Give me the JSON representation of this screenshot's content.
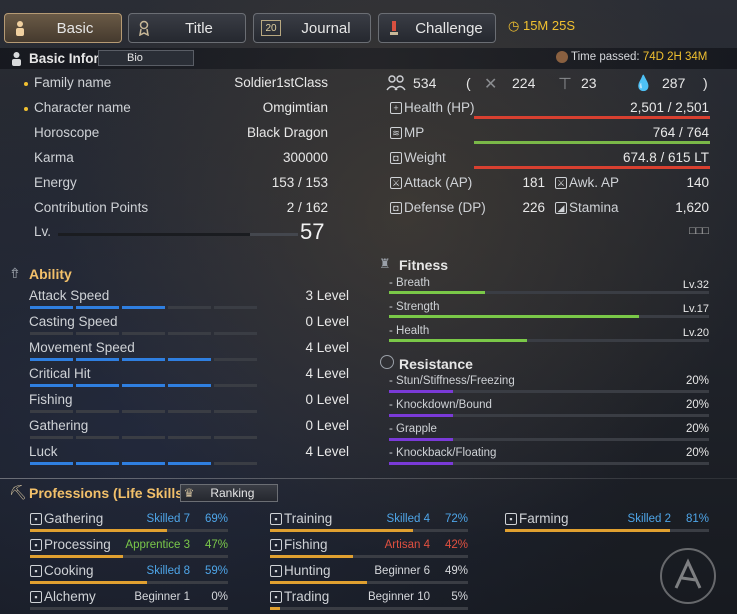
{
  "tabs": [
    {
      "label": "Basic",
      "icon": "person-icon",
      "active": true
    },
    {
      "label": "Title",
      "icon": "title-icon"
    },
    {
      "label": "Journal",
      "icon": "journal-icon"
    },
    {
      "label": "Challenge",
      "icon": "challenge-icon"
    }
  ],
  "journal_icon_text": "20",
  "timer": "15M 25S",
  "basic": {
    "title": "Basic Inform",
    "bio_label": "Bio",
    "time_label": "Time passed:",
    "time_value": "74D 2H 34M"
  },
  "info": [
    {
      "label": "Family name",
      "value": "Soldier1stClass"
    },
    {
      "label": "Character name",
      "value": "Omgimtian"
    },
    {
      "label": "Horoscope",
      "value": "Black Dragon"
    },
    {
      "label": "Karma",
      "value": "300000"
    },
    {
      "label": "Energy",
      "value": "153 / 153"
    },
    {
      "label": "Contribution Points",
      "value": "2 / 162"
    }
  ],
  "level": {
    "label": "Lv.",
    "value": "57",
    "progress": 0.8
  },
  "counts": {
    "a": "534",
    "open": "(",
    "b": "224",
    "c": "23",
    "d": "287",
    "close": ")"
  },
  "stats": [
    {
      "label": "Health (HP)",
      "value": "2,501 / 2,501",
      "color": "#d84030",
      "fill": 1.0
    },
    {
      "label": "MP",
      "value": "764 / 764",
      "color": "#7ab848",
      "fill": 1.0
    },
    {
      "label": "Weight",
      "value": "674.8 / 615 LT",
      "color": "#d84030",
      "fill": 1.0
    }
  ],
  "attack": {
    "label": "Attack (AP)",
    "value": "181",
    "awk_label": "Awk. AP",
    "awk_value": "140"
  },
  "defense": {
    "label": "Defense (DP)",
    "value": "226",
    "stam_label": "Stamina",
    "stam_value": "1,620"
  },
  "placeholder_text": "□□□",
  "ability": {
    "title": "Ability",
    "items": [
      {
        "label": "Attack Speed",
        "value": "3 Level",
        "segs": 3
      },
      {
        "label": "Casting Speed",
        "value": "0 Level",
        "segs": 0
      },
      {
        "label": "Movement Speed",
        "value": "4 Level",
        "segs": 4
      },
      {
        "label": "Critical Hit",
        "value": "4 Level",
        "segs": 4
      },
      {
        "label": "Fishing",
        "value": "0 Level",
        "segs": 0
      },
      {
        "label": "Gathering",
        "value": "0 Level",
        "segs": 0
      },
      {
        "label": "Luck",
        "value": "4 Level",
        "segs": 4
      }
    ]
  },
  "fitness": {
    "title": "Fitness",
    "items": [
      {
        "label": "- Breath",
        "value": "Lv.32",
        "fill": 0.3
      },
      {
        "label": "- Strength",
        "value": "Lv.17",
        "fill": 0.78
      },
      {
        "label": "- Health",
        "value": "Lv.20",
        "fill": 0.43
      }
    ]
  },
  "resistance": {
    "title": "Resistance",
    "items": [
      {
        "label": "- Stun/Stiffness/Freezing",
        "value": "20%",
        "fill": 0.2
      },
      {
        "label": "- Knockdown/Bound",
        "value": "20%",
        "fill": 0.2
      },
      {
        "label": "- Grapple",
        "value": "20%",
        "fill": 0.2
      },
      {
        "label": "- Knockback/Floating",
        "value": "20%",
        "fill": 0.2
      }
    ]
  },
  "professions": {
    "title": "Professions (Life Skills)",
    "ranking": "Ranking",
    "items": [
      {
        "label": "Gathering",
        "rank": "Skilled 7",
        "pct": "69%",
        "rank_color": "#4ea5e8",
        "fill": 0.69
      },
      {
        "label": "Processing",
        "rank": "Apprentice 3",
        "pct": "47%",
        "rank_color": "#7ac84a",
        "fill": 0.47
      },
      {
        "label": "Cooking",
        "rank": "Skilled 8",
        "pct": "59%",
        "rank_color": "#4ea5e8",
        "fill": 0.59
      },
      {
        "label": "Alchemy",
        "rank": "Beginner 1",
        "pct": "0%",
        "rank_color": "#d6d8dc",
        "fill": 0.0
      },
      {
        "label": "Training",
        "rank": "Skilled 4",
        "pct": "72%",
        "rank_color": "#4ea5e8",
        "fill": 0.72
      },
      {
        "label": "Fishing",
        "rank": "Artisan 4",
        "pct": "42%",
        "rank_color": "#e05040",
        "fill": 0.42
      },
      {
        "label": "Hunting",
        "rank": "Beginner 6",
        "pct": "49%",
        "rank_color": "#d6d8dc",
        "fill": 0.49
      },
      {
        "label": "Trading",
        "rank": "Beginner 10",
        "pct": "5%",
        "rank_color": "#d6d8dc",
        "fill": 0.05
      },
      {
        "label": "Farming",
        "rank": "Skilled 2",
        "pct": "81%",
        "rank_color": "#4ea5e8",
        "fill": 0.81
      }
    ]
  }
}
